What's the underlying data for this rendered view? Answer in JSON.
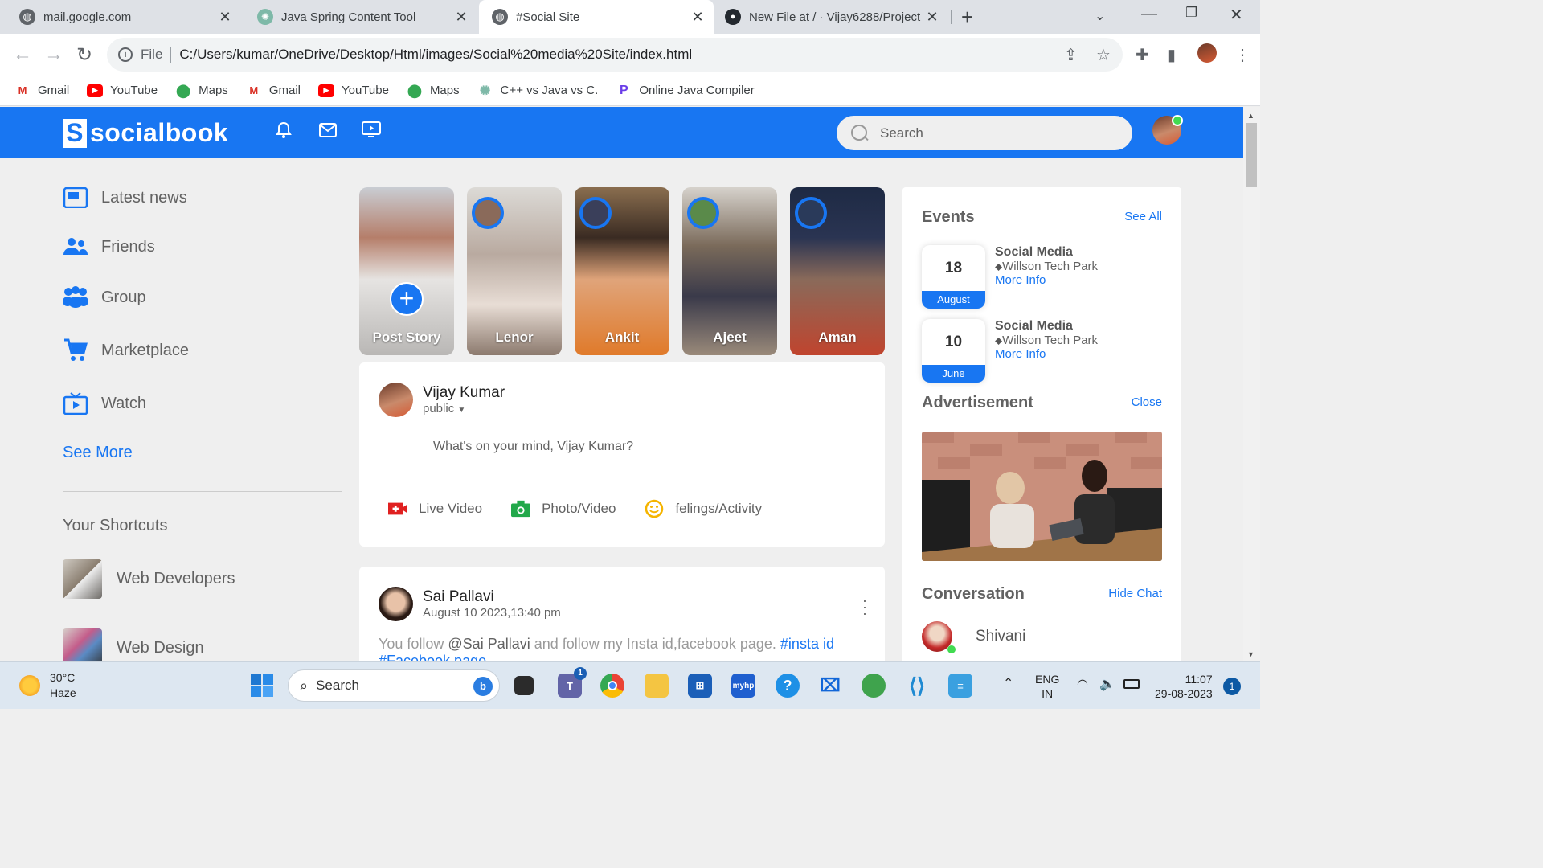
{
  "browser": {
    "tabs": [
      {
        "title": "mail.google.com",
        "icon": "globe-icon"
      },
      {
        "title": "Java Spring Content Tool",
        "icon": "chatgpt-icon"
      },
      {
        "title": "#Social Site",
        "icon": "globe-icon"
      },
      {
        "title": "New File at / · Vijay6288/Project_",
        "icon": "github-icon"
      }
    ],
    "address": {
      "scheme": "File",
      "url": "C:/Users/kumar/OneDrive/Desktop/Html/images/Social%20media%20Site/index.html"
    },
    "bookmarks": [
      {
        "label": "Gmail",
        "icon": "gmail-icon"
      },
      {
        "label": "YouTube",
        "icon": "youtube-icon"
      },
      {
        "label": "Maps",
        "icon": "maps-icon"
      },
      {
        "label": "Gmail",
        "icon": "gmail-icon"
      },
      {
        "label": "YouTube",
        "icon": "youtube-icon"
      },
      {
        "label": "Maps",
        "icon": "maps-icon"
      },
      {
        "label": "C++ vs Java vs C.",
        "icon": "chatgpt-icon"
      },
      {
        "label": "Online Java Compiler",
        "icon": "compiler-icon"
      }
    ]
  },
  "site": {
    "brand": "socialbook",
    "brand_letter": "S",
    "search_placeholder": "Search",
    "colors": {
      "primary": "#1876f2",
      "online": "#41db51"
    }
  },
  "left": {
    "links": [
      "Latest news",
      "Friends",
      "Group",
      "Marketplace",
      "Watch"
    ],
    "see_more": "See More",
    "shortcuts_title": "Your Shortcuts",
    "shortcuts": [
      "Web Developers",
      "Web Design"
    ]
  },
  "stories": [
    {
      "name": "Post Story",
      "plus": "+"
    },
    {
      "name": "Lenor"
    },
    {
      "name": "Ankit"
    },
    {
      "name": "Ajeet"
    },
    {
      "name": "Aman"
    }
  ],
  "composer": {
    "user": "Vijay Kumar",
    "privacy": "public",
    "placeholder": "What's on your mind, Vijay Kumar?",
    "actions": [
      "Live Video",
      "Photo/Video",
      "felings/Activity"
    ]
  },
  "post": {
    "user": "Sai Pallavi",
    "time": "August 10 2023,13:40 pm",
    "text_prefix": "You follow ",
    "mention": "@Sai Pallavi",
    "text_middle": " and follow my Insta id,facebook page. ",
    "tag1": "#insta id",
    "tag2": "#Facebook page"
  },
  "right": {
    "events_title": "Events",
    "events_link": "See All",
    "events": [
      {
        "day": "18",
        "month": "August",
        "title": "Social Media",
        "location": "Willson Tech Park",
        "more": "More Info"
      },
      {
        "day": "10",
        "month": "June",
        "title": "Social Media",
        "location": "Willson Tech Park",
        "more": "More Info"
      }
    ],
    "ad_title": "Advertisement",
    "ad_link": "Close",
    "conv_title": "Conversation",
    "conv_link": "Hide Chat",
    "contacts": [
      "Shivani"
    ]
  },
  "taskbar": {
    "temp": "30°C",
    "condition": "Haze",
    "search": "Search",
    "lang_top": "ENG",
    "lang_bottom": "IN",
    "time": "11:07",
    "date": "29-08-2023",
    "notifications": "1",
    "teams_badge": "1"
  }
}
